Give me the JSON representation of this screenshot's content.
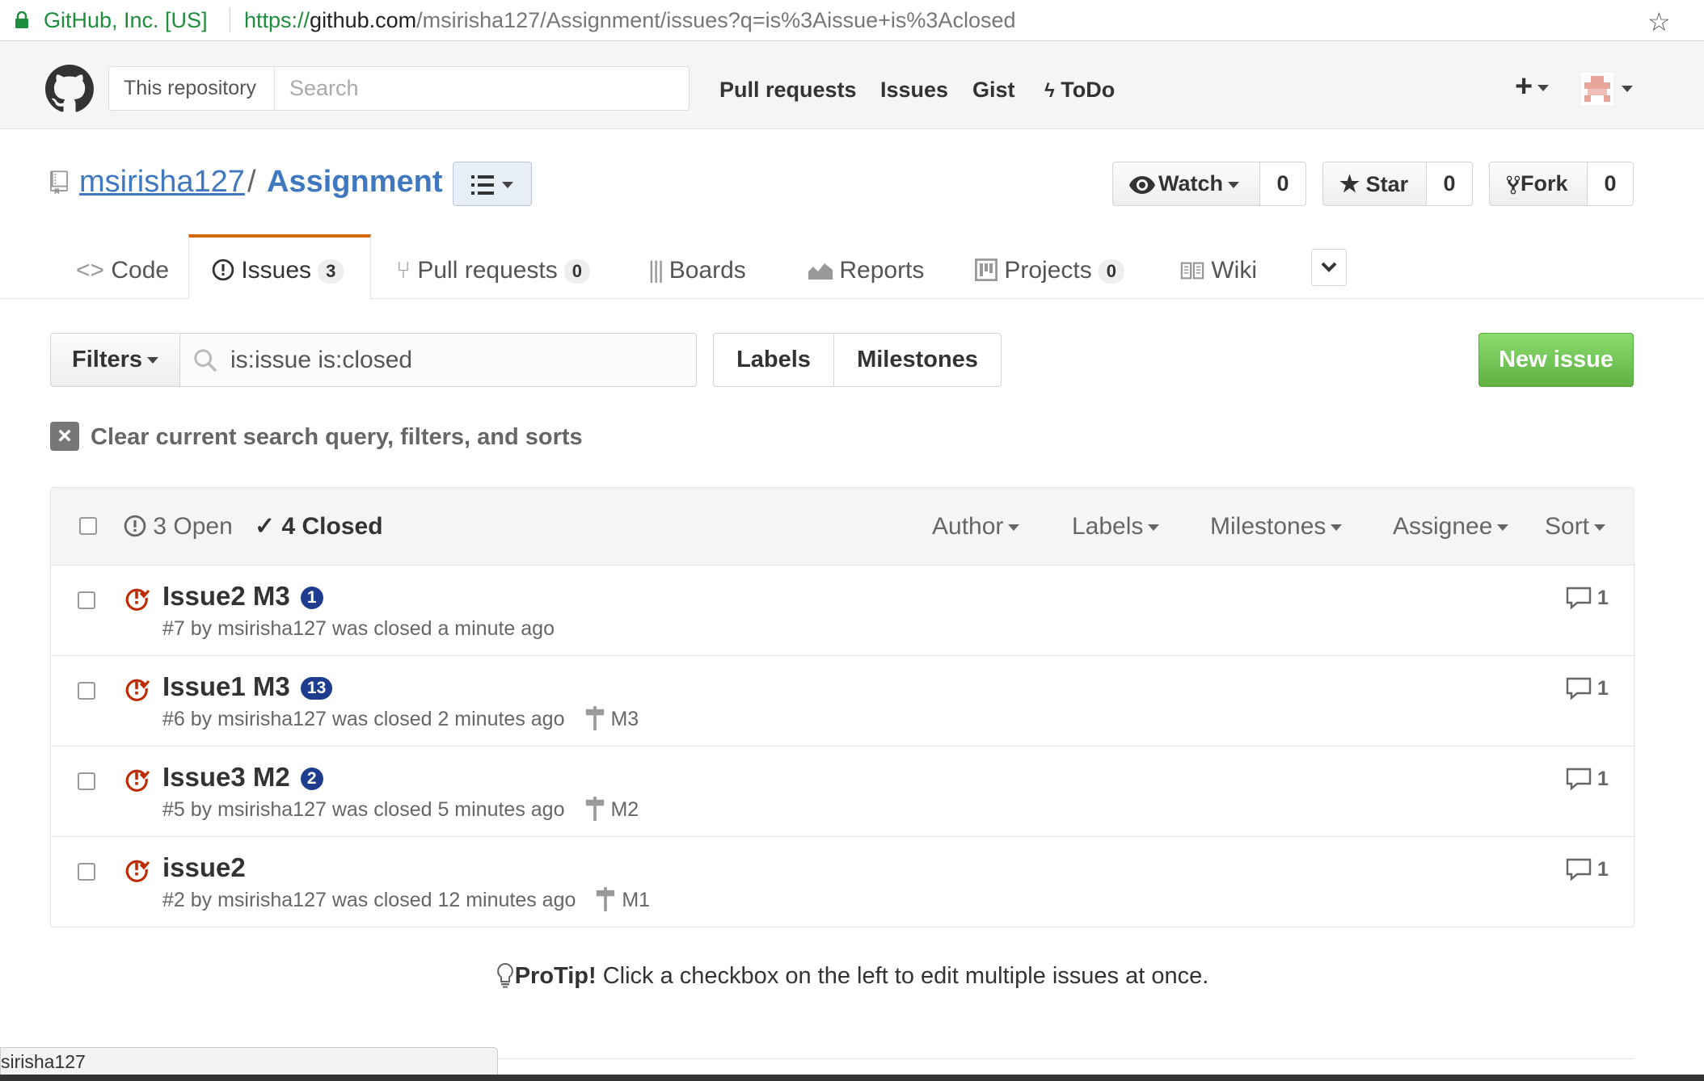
{
  "browser": {
    "secure_label": "GitHub, Inc. [US]",
    "url_scheme": "https://",
    "url_host": "github.com",
    "url_path": "/msirisha127/Assignment/issues?q=is%3Aissue+is%3Aclosed"
  },
  "header": {
    "search_scope": "This repository",
    "search_placeholder": "Search",
    "nav": [
      "Pull requests",
      "Issues",
      "Gist",
      "ToDo"
    ]
  },
  "repo": {
    "owner": "msirisha127",
    "separator": "/",
    "name": "Assignment",
    "watch_label": "Watch",
    "watch_count": "0",
    "star_label": "Star",
    "star_count": "0",
    "fork_label": "Fork",
    "fork_count": "0"
  },
  "tabs": [
    {
      "label": "Code"
    },
    {
      "label": "Issues",
      "count": "3"
    },
    {
      "label": "Pull requests",
      "count": "0"
    },
    {
      "label": "Boards"
    },
    {
      "label": "Reports"
    },
    {
      "label": "Projects",
      "count": "0"
    },
    {
      "label": "Wiki"
    }
  ],
  "toolbar": {
    "filters_label": "Filters",
    "query": "is:issue is:closed",
    "labels_label": "Labels",
    "milestones_label": "Milestones",
    "new_issue_label": "New issue",
    "clear_label": "Clear current search query, filters, and sorts"
  },
  "list_header": {
    "open_label": "3 Open",
    "closed_label": "4 Closed",
    "filters": [
      "Author",
      "Labels",
      "Milestones",
      "Assignee",
      "Sort"
    ]
  },
  "issues": [
    {
      "title": "Issue2 M3",
      "badge": "1",
      "meta": "#7 by msirisha127 was closed a minute ago",
      "milestone": "",
      "comments": "1"
    },
    {
      "title": "Issue1 M3",
      "badge": "13",
      "meta": "#6 by msirisha127 was closed 2 minutes ago",
      "milestone": "M3",
      "comments": "1"
    },
    {
      "title": "Issue3 M2",
      "badge": "2",
      "meta": "#5 by msirisha127 was closed 5 minutes ago",
      "milestone": "M2",
      "comments": "1"
    },
    {
      "title": "issue2",
      "badge": "",
      "meta": "#2 by msirisha127 was closed 12 minutes ago",
      "milestone": "M1",
      "comments": "1"
    }
  ],
  "protip": {
    "strong": "ProTip!",
    "text": " Click a checkbox on the left to edit multiple issues at once."
  },
  "status_bar": {
    "text": "sirisha127"
  },
  "colors": {
    "link": "#4078c0",
    "closed_icon": "#bd2c00",
    "active_tab": "#d26911",
    "new_issue": "#60b044",
    "badge": "#1f3d8f"
  }
}
